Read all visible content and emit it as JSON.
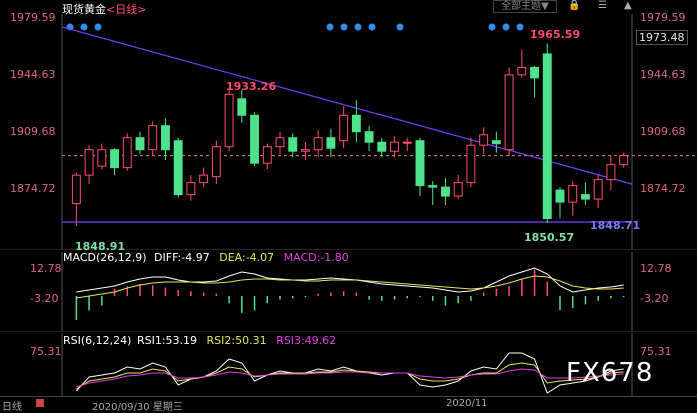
{
  "header": {
    "instrument": "现货黄金",
    "period": "<日线>",
    "theme_button": "全部主题▼",
    "icons": [
      "lock-icon",
      "menu-icon",
      "triangle-icon"
    ]
  },
  "main_axis": {
    "left_ticks": [
      "1979.59",
      "1944.63",
      "1909.68",
      "1874.72"
    ],
    "right_ticks": [
      "1979.59",
      "1944.63",
      "1909.68",
      "1874.72"
    ],
    "current_price": "1973.48"
  },
  "annotations": {
    "high_label": "1965.59",
    "mid_high_label": "1933.26",
    "low_left_label": "1848.91",
    "low_mid_label": "1850.57",
    "low_right_label": "1848.71"
  },
  "macd": {
    "title": "MACD(26,12,9)",
    "diff": "DIFF:-4.97",
    "dea": "DEA:-4.07",
    "macd": "MACD:-1.80",
    "ticks": [
      "12.78",
      "-3.20"
    ]
  },
  "rsi": {
    "title": "RSI(6,12,24)",
    "rsi1": "RSI1:53.19",
    "rsi2": "RSI2:50.31",
    "rsi3": "RSI3:49.62",
    "ticks": [
      "75.31"
    ]
  },
  "footer": {
    "date_label": "2020/09/30 星期三",
    "month_label": "2020/11",
    "corner_label": "日线"
  },
  "watermark": "FX678",
  "chart_data": {
    "type": "candlestick",
    "title": "现货黄金 日线",
    "y_range": [
      1840,
      1985
    ],
    "candles": [
      [
        1861,
        1880,
        1846,
        1882
      ],
      [
        1880,
        1897,
        1874,
        1900
      ],
      [
        1886,
        1897,
        1884,
        1901
      ],
      [
        1897,
        1885,
        1880,
        1898
      ],
      [
        1885,
        1905,
        1883,
        1908
      ],
      [
        1905,
        1897,
        1894,
        1909
      ],
      [
        1897,
        1913,
        1893,
        1916
      ],
      [
        1913,
        1897,
        1890,
        1918
      ],
      [
        1903,
        1867,
        1865,
        1905
      ],
      [
        1867,
        1875,
        1863,
        1880
      ],
      [
        1875,
        1880,
        1872,
        1885
      ],
      [
        1879,
        1899,
        1874,
        1903
      ],
      [
        1899,
        1934,
        1896,
        1937
      ],
      [
        1931,
        1920,
        1915,
        1937
      ],
      [
        1920,
        1888,
        1886,
        1922
      ],
      [
        1888,
        1899,
        1884,
        1901
      ],
      [
        1899,
        1905,
        1894,
        1909
      ],
      [
        1905,
        1896,
        1892,
        1908
      ],
      [
        1896,
        1897,
        1890,
        1902
      ],
      [
        1897,
        1905,
        1892,
        1910
      ],
      [
        1905,
        1898,
        1892,
        1911
      ],
      [
        1903,
        1920,
        1898,
        1926
      ],
      [
        1920,
        1909,
        1902,
        1930
      ],
      [
        1909,
        1902,
        1896,
        1913
      ],
      [
        1902,
        1896,
        1892,
        1905
      ],
      [
        1896,
        1902,
        1892,
        1906
      ],
      [
        1902,
        1902,
        1896,
        1905
      ],
      [
        1903,
        1873,
        1866,
        1905
      ],
      [
        1873,
        1872,
        1860,
        1876
      ],
      [
        1872,
        1866,
        1860,
        1878
      ],
      [
        1866,
        1875,
        1864,
        1880
      ],
      [
        1875,
        1900,
        1872,
        1905
      ],
      [
        1900,
        1907,
        1894,
        1912
      ],
      [
        1903,
        1901,
        1895,
        1909
      ],
      [
        1897,
        1947,
        1893,
        1952
      ],
      [
        1947,
        1952,
        1945,
        1964
      ],
      [
        1952,
        1945,
        1932,
        1953
      ],
      [
        1961,
        1851,
        1848,
        1968
      ],
      [
        1870,
        1862,
        1851,
        1872
      ],
      [
        1862,
        1873,
        1853,
        1876
      ],
      [
        1867,
        1864,
        1860,
        1875
      ],
      [
        1864,
        1877,
        1858,
        1880
      ],
      [
        1877,
        1887,
        1870,
        1893
      ],
      [
        1887,
        1893,
        1885,
        1895
      ]
    ],
    "trendline": {
      "from": [
        0,
        1979
      ],
      "to": [
        43,
        1874
      ]
    },
    "support_line": 1848.71,
    "macd_values": {
      "diff": -4.97,
      "dea": -4.07,
      "macd": -1.8
    },
    "rsi_values": {
      "rsi1": 53.19,
      "rsi2": 50.31,
      "rsi3": 49.62
    }
  }
}
